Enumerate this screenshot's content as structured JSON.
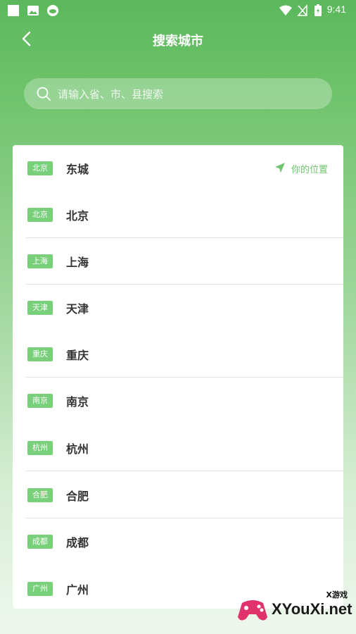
{
  "status_bar": {
    "time": "9:41"
  },
  "header": {
    "title": "搜索城市"
  },
  "search": {
    "placeholder": "请输入省、市、县搜索"
  },
  "current_location": {
    "label": "你的位置"
  },
  "cities": [
    {
      "tag": "北京",
      "name": "东城",
      "current": true
    },
    {
      "tag": "北京",
      "name": "北京"
    },
    {
      "tag": "上海",
      "name": "上海"
    },
    {
      "tag": "天津",
      "name": "天津"
    },
    {
      "tag": "重庆",
      "name": "重庆"
    },
    {
      "tag": "南京",
      "name": "南京"
    },
    {
      "tag": "杭州",
      "name": "杭州"
    },
    {
      "tag": "合肥",
      "name": "合肥"
    },
    {
      "tag": "成都",
      "name": "成都"
    },
    {
      "tag": "广州",
      "name": "广州"
    }
  ],
  "watermark": {
    "text": "XYouXi.net",
    "small": "X游戏"
  },
  "colors": {
    "accent": "#5cb85c",
    "tag_bg": "#78d07a",
    "location": "#6ec46e"
  }
}
